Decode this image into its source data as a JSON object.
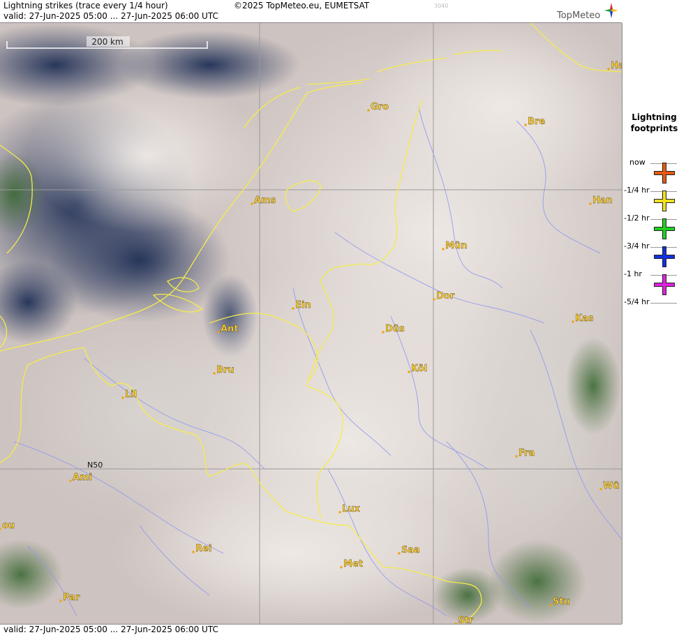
{
  "header": {
    "title": "Lightning strikes (trace every 1/4 hour)",
    "valid": "valid:  27-Jun-2025 05:00 ... 27-Jun-2025 06:00 UTC",
    "copyright": "©2025 TopMeteo.eu, EUMETSAT",
    "stamp": "3040",
    "logo": "TopMeteo"
  },
  "footer": {
    "valid": "valid:  27-Jun-2025 05:00 ... 27-Jun-2025 06:00 UTC"
  },
  "map": {
    "scale_label": "200 km",
    "lat_label": "N50",
    "colors": {
      "border": "#f5ec4a",
      "river": "#8f98f0",
      "grid": "#9a9a9a",
      "city_dot": "#f0a000",
      "city_label": "#ffd23a"
    },
    "cities": [
      {
        "name": "Gro"
      },
      {
        "name": "Bre"
      },
      {
        "name": "Ha"
      },
      {
        "name": "Ams"
      },
      {
        "name": "Han"
      },
      {
        "name": "Mün"
      },
      {
        "name": "Dor"
      },
      {
        "name": "Ein"
      },
      {
        "name": "Ant"
      },
      {
        "name": "Düs"
      },
      {
        "name": "Kas"
      },
      {
        "name": "Bru"
      },
      {
        "name": "Köl"
      },
      {
        "name": "Lil"
      },
      {
        "name": "Fra"
      },
      {
        "name": "Ami"
      },
      {
        "name": "Wü"
      },
      {
        "name": "Lux"
      },
      {
        "name": "ou"
      },
      {
        "name": "Rei"
      },
      {
        "name": "Saa"
      },
      {
        "name": "Met"
      },
      {
        "name": "Par"
      },
      {
        "name": "Stu"
      },
      {
        "name": "Str"
      }
    ]
  },
  "legend": {
    "title_line1": "Lightning",
    "title_line2": "footprints",
    "items": [
      {
        "label": "now",
        "color": ""
      },
      {
        "label": "-1/4 hr",
        "color": "#e85a10"
      },
      {
        "label": "-1/2 hr",
        "color": "#f0e020"
      },
      {
        "label": "-3/4 hr",
        "color": "#20d020"
      },
      {
        "label": "-1 hr",
        "color": "#1030e0"
      },
      {
        "label": "-5/4 hr",
        "color": "#e020e0"
      }
    ]
  }
}
